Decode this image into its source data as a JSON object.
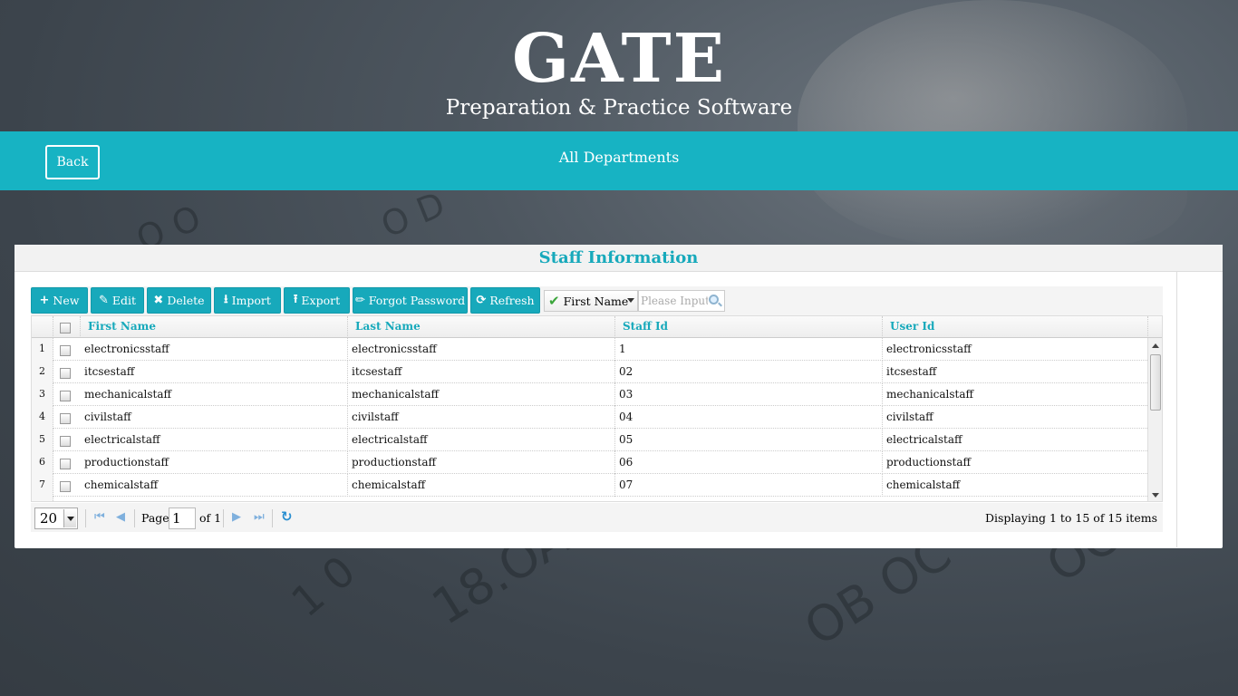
{
  "header": {
    "title": "GATE",
    "subtitle": "Preparation & Practice Software"
  },
  "nav": {
    "back_label": "Back",
    "section_title": "All Departments"
  },
  "panel": {
    "title": "Staff Information"
  },
  "toolbar": {
    "new_label": "New",
    "edit_label": "Edit",
    "delete_label": "Delete",
    "import_label": "Import",
    "export_label": "Export",
    "forgot_label": "Forgot Password",
    "refresh_label": "Refresh"
  },
  "search": {
    "field": "First Name",
    "placeholder": "Please Input Value"
  },
  "grid": {
    "columns": [
      "First Name",
      "Last Name",
      "Staff Id",
      "User Id"
    ],
    "rows": [
      {
        "n": "1",
        "first": "electronicsstaff",
        "last": "electronicsstaff",
        "id": "1",
        "user": "electronicsstaff"
      },
      {
        "n": "2",
        "first": "itcsestaff",
        "last": "itcsestaff",
        "id": "02",
        "user": "itcsestaff"
      },
      {
        "n": "3",
        "first": "mechanicalstaff",
        "last": "mechanicalstaff",
        "id": "03",
        "user": "mechanicalstaff"
      },
      {
        "n": "4",
        "first": "civilstaff",
        "last": "civilstaff",
        "id": "04",
        "user": "civilstaff"
      },
      {
        "n": "5",
        "first": "electricalstaff",
        "last": "electricalstaff",
        "id": "05",
        "user": "electricalstaff"
      },
      {
        "n": "6",
        "first": "productionstaff",
        "last": "productionstaff",
        "id": "06",
        "user": "productionstaff"
      },
      {
        "n": "7",
        "first": "chemicalstaff",
        "last": "chemicalstaff",
        "id": "07",
        "user": "chemicalstaff"
      }
    ]
  },
  "pager": {
    "page_size": "20",
    "page_label": "Page",
    "page_value": "1",
    "of_label": "of 1",
    "display_info": "Displaying 1 to 15 of 15 items"
  },
  "colors": {
    "accent": "#17b3c3",
    "header_text": "#17a9bb"
  }
}
